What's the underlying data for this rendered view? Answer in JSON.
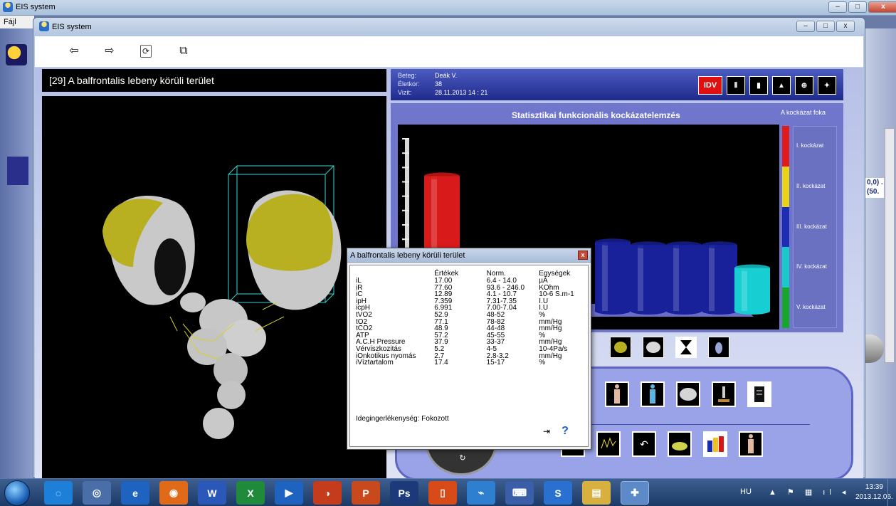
{
  "outer_window": {
    "title": "EIS system",
    "menu_first": "Fájl"
  },
  "window": {
    "title": "EIS system"
  },
  "toolbar": {
    "back_icon": "⇦",
    "forward_icon": "⇨",
    "refresh_icon": "⟳",
    "copy_icon": "⧉"
  },
  "brain_panel": {
    "title": "[29] A balfrontalis lebeny körüli terület"
  },
  "patient": {
    "labels": [
      "Beteg:",
      "Életkor:",
      "Vizit:"
    ],
    "values": [
      "Deák V.",
      "38",
      "28.11.2013  14 : 21"
    ]
  },
  "header_icons": [
    "IDV",
    "⦀",
    "▮",
    "▲",
    "⊕",
    "✦"
  ],
  "chart": {
    "title": "Statisztikai funkcionális kockázatelemzés",
    "risk_title": "A kockázat foka",
    "risk_levels": [
      "I. kockázat",
      "II. kockázat",
      "III. kockázat",
      "IV. kockázat",
      "V. kockázat"
    ],
    "risk_colors": [
      "#e11b1b",
      "#e8d21a",
      "#1f2db6",
      "#19c8c8",
      "#18a62c"
    ]
  },
  "chart_data": {
    "type": "bar",
    "categories": [
      "",
      "",
      "",
      "",
      "",
      ""
    ],
    "values": [
      4.7,
      2.4,
      2.3,
      2.3,
      2.3,
      1.5
    ],
    "colors": [
      "#d81a1a",
      "#18209a",
      "#18209a",
      "#18209a",
      "#18209a",
      "#17cfd3"
    ],
    "title": "Statisztikai funkcionális kockázatelemzés",
    "xlabel": "",
    "ylabel": "",
    "ylim": [
      0,
      6
    ]
  },
  "popup": {
    "title": "A balfrontalis lebeny körüli terület",
    "close_label": "x",
    "headers": [
      "",
      "Értékek",
      "Norm.",
      "Egységek"
    ],
    "rows": [
      [
        "iL",
        "17.00",
        "6.4 - 14.0",
        "µA"
      ],
      [
        "iR",
        "77.60",
        "93.6 - 246.0",
        "KOhm"
      ],
      [
        "iC",
        "12.89",
        "4.1 - 10.7",
        "10-6 S.m-1"
      ],
      [
        "ipH",
        "7.359",
        "7.31-7.35",
        "I.U"
      ],
      [
        "icpH",
        "6.991",
        "7.00-7.04",
        "I.U"
      ],
      [
        "tVO2",
        "52.9",
        "48-52",
        "%"
      ],
      [
        "tO2",
        "77.1",
        "78-82",
        "mm/Hg"
      ],
      [
        "tCO2",
        "48.9",
        "44-48",
        "mm/Hg"
      ],
      [
        "ATP",
        "57.2",
        "45-55",
        "%"
      ],
      [
        "A.C.H Pressure",
        "37.9",
        "33-37",
        "mm/Hg"
      ],
      [
        "Vérviszkozitás",
        "5.2",
        "4-5",
        "10-4Pa/s"
      ],
      [
        "iOnkotikus nyomás",
        "2.7",
        "2.8-3.2",
        "mm/Hg"
      ],
      [
        "iVíztartalom",
        "17.4",
        "15-17",
        "%"
      ]
    ],
    "sensitivity": "Idegingerlékenység: Fokozott",
    "exit_icon": "⇥",
    "help_icon": "?"
  },
  "taskbar": {
    "apps": [
      "◌",
      "◎",
      "e",
      "◉",
      "W",
      "X",
      "▶",
      "◑",
      "P",
      "Ps",
      "▯",
      "⌁",
      "⌨",
      "S",
      "▤",
      "✚"
    ],
    "language": "HU",
    "tray_icons": "▲ ⚑ ▦ ıl ◂",
    "time": "13:39",
    "date": "2013.12.06."
  },
  "side": {
    "coord_top": "0,0) .",
    "coord_bottom": "(50."
  }
}
